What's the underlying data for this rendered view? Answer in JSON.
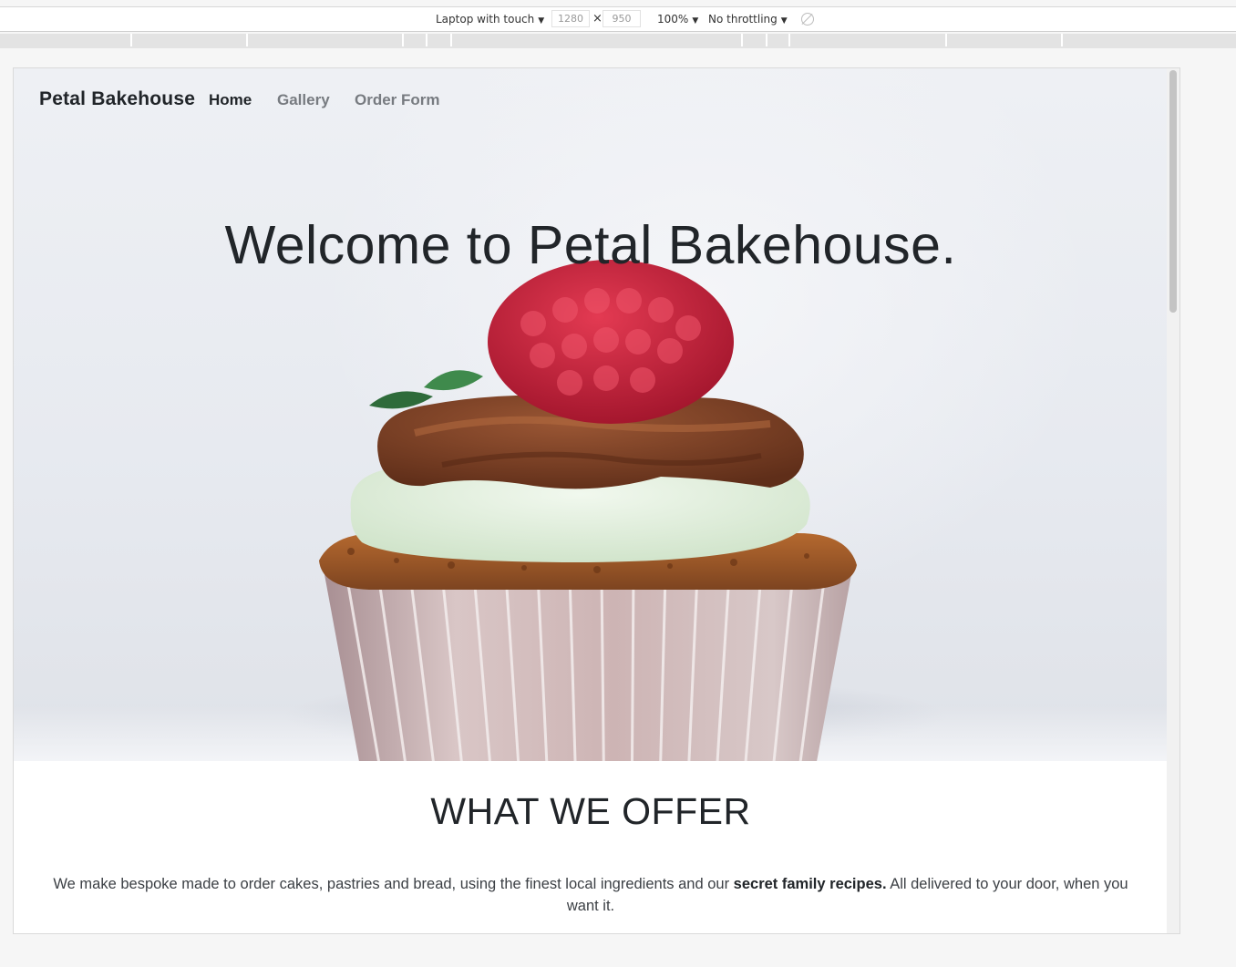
{
  "devtools": {
    "device": "Laptop with touch",
    "width": "1280",
    "height": "950",
    "times": "×",
    "zoom": "100%",
    "throttling": "No throttling",
    "caret": "▼"
  },
  "nav": {
    "brand": "Petal Bakehouse",
    "links": [
      "Home",
      "Gallery",
      "Order Form"
    ],
    "active": "Home"
  },
  "hero": {
    "title": "Welcome to Petal Bakehouse."
  },
  "offer": {
    "heading": "WHAT WE OFFER",
    "text_before": "We make bespoke made to order cakes, pastries and bread, using the finest local ingredients and our ",
    "text_bold": "secret family recipes.",
    "text_after": " All delivered to your door, when you want it."
  },
  "colors": {
    "text": "#212529",
    "nav_inactive": "#777b80",
    "frosting_chocolate": "#7a4128",
    "cream": "#e6f3e2",
    "raspberry": "#c8203a",
    "wrapper": "#cdb4b4"
  }
}
